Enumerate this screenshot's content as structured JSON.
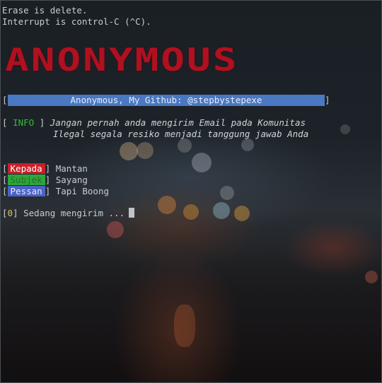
{
  "terminal": {
    "line1": "Erase is delete.",
    "line2": "Interrupt is control-C (^C).",
    "logo_text": "ANONYMOUS",
    "banner_open": "[",
    "banner_text": "Anonymous, My Github: @stepbystepexe",
    "banner_close": "]",
    "info": {
      "open": "[",
      "tag": "INFO",
      "close": "]",
      "message_line1": "Jangan pernah anda mengirim Email pada Komunitas",
      "message_line2": "Ilegal segala resiko menjadi tanggung jawab Anda"
    },
    "fields": [
      {
        "label": "Kepada",
        "value": "Mantan"
      },
      {
        "label": "Subjek",
        "value": "Sayang"
      },
      {
        "label": "Pessan",
        "value": "Tapi Boong"
      }
    ],
    "status": {
      "open": "[",
      "spinner": "0",
      "close": "]",
      "text": "Sedang mengirim ..."
    }
  },
  "colors": {
    "logo": "#b01020",
    "banner_bg": "#4a78c2",
    "info_tag": "#2fbf3a",
    "kepada_bg": "#c8202a",
    "subjek_bg": "#2aa83a",
    "pessan_bg": "#4b62c6"
  }
}
